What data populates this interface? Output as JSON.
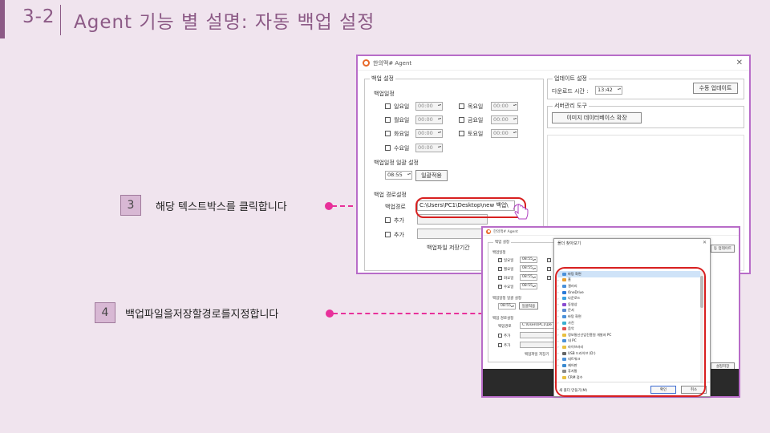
{
  "slide": {
    "number": "3-2",
    "title": "Agent 기능 별 설명: 자동 백업 설정"
  },
  "callouts": [
    {
      "step": "3",
      "text": "해당 텍스트박스를 클릭합니다"
    },
    {
      "step": "4",
      "text": "백업파일을저장할경로를지정합니다"
    }
  ],
  "agent_window": {
    "title": "한의맥# Agent",
    "backup_group": "백업 설정",
    "schedule_label": "백업일정",
    "days": [
      {
        "label": "일요일",
        "time": "00:00"
      },
      {
        "label": "월요일",
        "time": "00:00"
      },
      {
        "label": "화요일",
        "time": "00:00"
      },
      {
        "label": "수요일",
        "time": "00:00"
      },
      {
        "label": "목요일",
        "time": "00:00"
      },
      {
        "label": "금요일",
        "time": "00:00"
      },
      {
        "label": "토요일",
        "time": "00:00"
      }
    ],
    "bulk_label": "백업일정 일괄 설정",
    "bulk_time": "08:55",
    "bulk_apply": "일괄적용",
    "path_section": "백업 경로설정",
    "path_label": "백업경로",
    "path_value": "C:\\Users\\PC1\\Desktop\\new 백업\\",
    "add_label": "추가",
    "retention_label": "백업파일 저장기간",
    "update_group": "업데이트 설정",
    "download_time_label": "다운로드 시간 :",
    "download_time": "13:42",
    "manual_update": "수동 업데이트",
    "server_group": "서버관리 도구",
    "image_db_expand": "이미지 데이터베이스 확장"
  },
  "agent_window_small": {
    "title": "한의맥# Agent",
    "backup_group": "백업 설정",
    "schedule_label": "백업일정",
    "days": [
      {
        "label": "일요일",
        "time": "08:55"
      },
      {
        "label": "월요일",
        "time": "08:55"
      },
      {
        "label": "화요일",
        "time": "08:55"
      },
      {
        "label": "수요일",
        "time": "08:55"
      }
    ],
    "bulk_label": "백업일정 일괄 설정",
    "bulk_time": "08:55",
    "bulk_apply": "일괄적용",
    "path_section": "백업 경로설정",
    "path_label": "백업경로",
    "path_value": "C:\\Users\\PC1\\De",
    "add_label": "추가",
    "retention_label": "백업파일 저장기",
    "manual_update": "동 업데이트",
    "save_settings": "설정저장"
  },
  "folder_dialog": {
    "title": "폴더 찾아보기",
    "items": [
      {
        "label": "바탕 화면",
        "icon_color": "#4a90d9",
        "chev": ""
      },
      {
        "label": "홈",
        "icon_color": "#e8a030",
        "chev": "›"
      },
      {
        "label": "갤러리",
        "icon_color": "#4a90d9",
        "chev": "›"
      },
      {
        "label": "OneDrive",
        "icon_color": "#2a7ad8",
        "chev": "›"
      },
      {
        "label": "다운로드",
        "icon_color": "#3aa0e0",
        "chev": "›"
      },
      {
        "label": "동영상",
        "icon_color": "#8a4ad0",
        "chev": "›"
      },
      {
        "label": "문서",
        "icon_color": "#5a8ad0",
        "chev": "›"
      },
      {
        "label": "바탕 화면",
        "icon_color": "#4a90d9",
        "chev": "›"
      },
      {
        "label": "사진",
        "icon_color": "#3ab0d0",
        "chev": "›"
      },
      {
        "label": "음악",
        "icon_color": "#e05050",
        "chev": "›"
      },
      {
        "label": "정보통신산업진흥원 개발자 PC",
        "icon_color": "#e8c040",
        "chev": "›"
      },
      {
        "label": "내 PC",
        "icon_color": "#4a90d9",
        "chev": "›"
      },
      {
        "label": "라이브러리",
        "icon_color": "#e8c040",
        "chev": "›"
      },
      {
        "label": "USB 드라이브 (D:)",
        "icon_color": "#666666",
        "chev": "›"
      },
      {
        "label": "네트워크",
        "icon_color": "#4a90d9",
        "chev": "›"
      },
      {
        "label": "제어판",
        "icon_color": "#3a8ad0",
        "chev": "›"
      },
      {
        "label": "휴지통",
        "icon_color": "#888888",
        "chev": ""
      },
      {
        "label": "CRM 접수",
        "icon_color": "#e8c040",
        "chev": ""
      }
    ],
    "new_folder": "새 폴더 만들기(M)",
    "ok": "확인",
    "cancel": "취소"
  },
  "colors": {
    "accent": "#8c5a86",
    "highlight_red": "#d82020",
    "pointer_pink": "#e8309a",
    "window_border": "#b86cc8"
  }
}
